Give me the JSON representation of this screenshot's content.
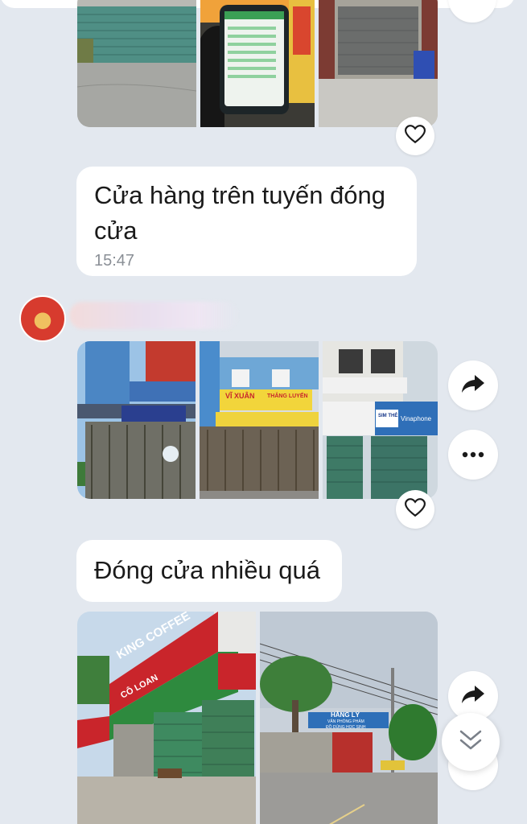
{
  "messages": [
    {
      "text": "Cửa hàng trên tuyến đóng cửa",
      "time": "15:47"
    },
    {
      "text": "Đóng cửa nhiều quá"
    }
  ],
  "sender": {
    "name": ""
  },
  "photo_signs": {
    "p5_top": "VĨ XUÂN",
    "p5_right": "THẮNG LUYẾN",
    "p6_sign": "SIM THẺ",
    "p6_brand": "Vinaphone",
    "p7_brand": "KING COFFEE",
    "p7_shop": "CÔ LOAN",
    "p8_sign": "HẰNG LÝ",
    "p8_sub": "VĂN PHÒNG PHẨM",
    "p8_sub2": "ĐỒ DÙNG HỌC SINH"
  },
  "icons": {
    "heart": "heart-icon",
    "forward": "forward-icon",
    "more": "more-icon",
    "scroll": "double-chevron-down-icon"
  },
  "colors": {
    "background": "#e3e8ef",
    "bubble": "#ffffff",
    "icon": "#1a1a1a"
  }
}
